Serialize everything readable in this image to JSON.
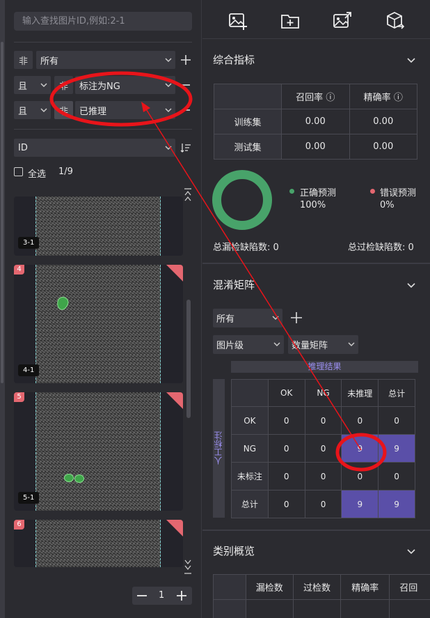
{
  "search": {
    "placeholder": "输入查找图片ID,例如:2-1"
  },
  "filters": [
    {
      "logic": "",
      "not": "非",
      "value": "所有"
    },
    {
      "logic": "且",
      "not": "非",
      "value": "标注为NG"
    },
    {
      "logic": "且",
      "not": "非",
      "value": "已推理"
    }
  ],
  "sort": {
    "field": "ID"
  },
  "select_all": {
    "label": "全选",
    "count": "1/9"
  },
  "images": [
    {
      "num": "",
      "id": "3-1"
    },
    {
      "num": "4",
      "id": "4-1"
    },
    {
      "num": "5",
      "id": "5-1"
    },
    {
      "num": "6",
      "id": ""
    }
  ],
  "pager": {
    "page": "1"
  },
  "toolbar": {
    "icons": [
      "add-image-icon",
      "add-folder-icon",
      "export-image-icon",
      "package-export-icon"
    ]
  },
  "metrics": {
    "title": "综合指标",
    "col_recall": "召回率",
    "col_precision": "精确率",
    "rows": [
      {
        "label": "训练集",
        "recall": "0.00",
        "precision": "0.00"
      },
      {
        "label": "测试集",
        "recall": "0.00",
        "precision": "0.00"
      }
    ],
    "correct_label": "正确预测",
    "correct_value": "100%",
    "wrong_label": "错误预测",
    "wrong_value": "0%",
    "missed": "总漏检缺陷数: 0",
    "over": "总过检缺陷数: 0",
    "colors": {
      "correct": "#48a36a",
      "wrong": "#e46770"
    }
  },
  "confusion": {
    "title": "混淆矩阵",
    "filter": "所有",
    "level": "图片级",
    "mode": "数量矩阵",
    "pred_header": "推理结果",
    "gt_header": "人工标注",
    "cols": [
      "OK",
      "NG",
      "未推理",
      "总计"
    ],
    "rows": [
      {
        "label": "OK",
        "values": [
          "0",
          "0",
          "0",
          "0"
        ]
      },
      {
        "label": "NG",
        "values": [
          "0",
          "0",
          "9",
          "9"
        ]
      },
      {
        "label": "未标注",
        "values": [
          "0",
          "0",
          "0",
          "0"
        ]
      },
      {
        "label": "总计",
        "values": [
          "0",
          "0",
          "9",
          "9"
        ]
      }
    ],
    "highlight_color": "#5a4fa8"
  },
  "category": {
    "title": "类别概览",
    "cols": [
      "漏检数",
      "过检数",
      "精确率",
      "召回"
    ]
  }
}
